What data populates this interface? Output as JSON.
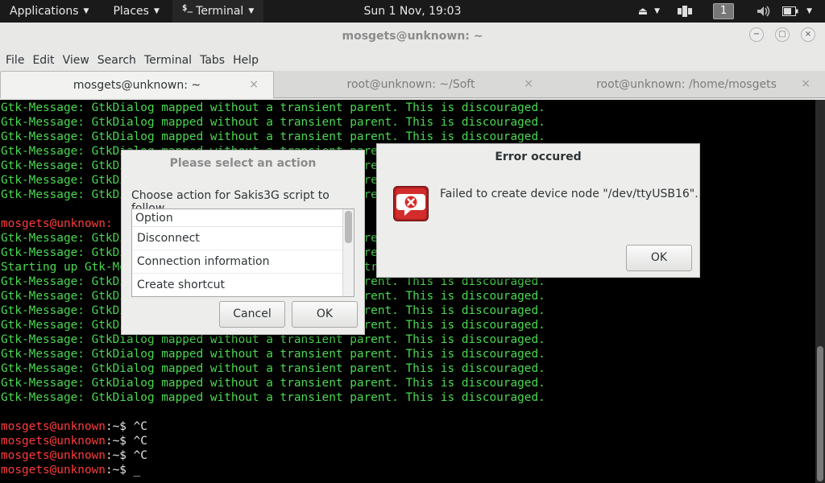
{
  "top_panel": {
    "applications": "Applications",
    "places": "Places",
    "terminal_glyph": "$_",
    "terminal": "Terminal",
    "clock": "Sun  1 Nov, 19:03",
    "workspace": "1"
  },
  "window": {
    "title": "mosgets@unknown: ~",
    "minimize": "−",
    "maximize": "□",
    "close": "×"
  },
  "menubar": [
    "File",
    "Edit",
    "View",
    "Search",
    "Terminal",
    "Tabs",
    "Help"
  ],
  "tabs": [
    {
      "label": "mosgets@unknown: ~",
      "close": "×"
    },
    {
      "label": "root@unknown: ~/Soft",
      "close": "×"
    },
    {
      "label": "root@unknown: /home/mosgets",
      "close": "×"
    }
  ],
  "terminal": {
    "lines": [
      {
        "cls": "green",
        "text": "Gtk-Message: GtkDialog mapped without a transient parent. This is discouraged."
      },
      {
        "cls": "green",
        "text": "Gtk-Message: GtkDialog mapped without a transient parent. This is discouraged."
      },
      {
        "cls": "green",
        "text": "Gtk-Message: GtkDialog mapped without a transient parent. This is discouraged."
      },
      {
        "cls": "green",
        "text": "Gtk-Message: GtkDialog mapped without a transient parent. This is discouraged."
      },
      {
        "cls": "green",
        "text": "Gtk-Message: GtkDialog mapped without a transient parent. This is discouraged."
      },
      {
        "cls": "green",
        "text": "Gtk-Message: GtkDialog mapped without a transient parent. This is discouraged."
      },
      {
        "cls": "green",
        "text": "Gtk-Message: GtkDialog mapped without a transient parent. This is discouraged."
      },
      {
        "cls": "green",
        "text": ""
      },
      {
        "cls": "red",
        "text": "mosgets@unknown:"
      },
      {
        "cls": "green",
        "text": "Gtk-Message: GtkDialog mapped without a transient parent. This is discouraged."
      },
      {
        "cls": "green",
        "text": "Gtk-Message: GtkDialog mapped without a transient parent. This is discouraged."
      },
      {
        "cls": "green",
        "text": "Starting up Gtk-Message: GtkDialog mapped without a transient parent. This is discouraged."
      },
      {
        "cls": "green",
        "text": "Gtk-Message: GtkDialog mapped without a transient parent. This is discouraged."
      },
      {
        "cls": "green",
        "text": "Gtk-Message: GtkDialog mapped without a transient parent. This is discouraged."
      },
      {
        "cls": "green",
        "text": "Gtk-Message: GtkDialog mapped without a transient parent. This is discouraged."
      },
      {
        "cls": "green",
        "text": "Gtk-Message: GtkDialog mapped without a transient parent. This is discouraged."
      },
      {
        "cls": "green",
        "text": "Gtk-Message: GtkDialog mapped without a transient parent. This is discouraged."
      },
      {
        "cls": "green",
        "text": "Gtk-Message: GtkDialog mapped without a transient parent. This is discouraged."
      },
      {
        "cls": "green",
        "text": "Gtk-Message: GtkDialog mapped without a transient parent. This is discouraged."
      },
      {
        "cls": "green",
        "text": "Gtk-Message: GtkDialog mapped without a transient parent. This is discouraged."
      },
      {
        "cls": "green",
        "text": "Gtk-Message: GtkDialog mapped without a transient parent. This is discouraged."
      },
      {
        "cls": "green",
        "text": ""
      }
    ],
    "prompts": [
      {
        "user": "mosgets@unknown",
        "sep": ":~$ ",
        "cmd": "^C"
      },
      {
        "user": "mosgets@unknown",
        "sep": ":~$ ",
        "cmd": "^C"
      },
      {
        "user": "mosgets@unknown",
        "sep": ":~$ ",
        "cmd": "^C"
      },
      {
        "user": "mosgets@unknown",
        "sep": ":~$ ",
        "cmd": "_"
      }
    ]
  },
  "action_dialog": {
    "title": "Please select an action",
    "prompt": "Choose action for Sakis3G script to follow.",
    "list_header": "Option",
    "options": [
      "Disconnect",
      "Connection information",
      "Create shortcut"
    ],
    "cancel": "Cancel",
    "ok": "OK"
  },
  "error_dialog": {
    "title": "Error occured",
    "message": "Failed to create device node \"/dev/ttyUSB16\".",
    "ok": "OK"
  },
  "colors": {
    "terminal_green": "#4ad950",
    "prompt_red": "#ff3b3b",
    "error_icon": "#d42c2c"
  }
}
